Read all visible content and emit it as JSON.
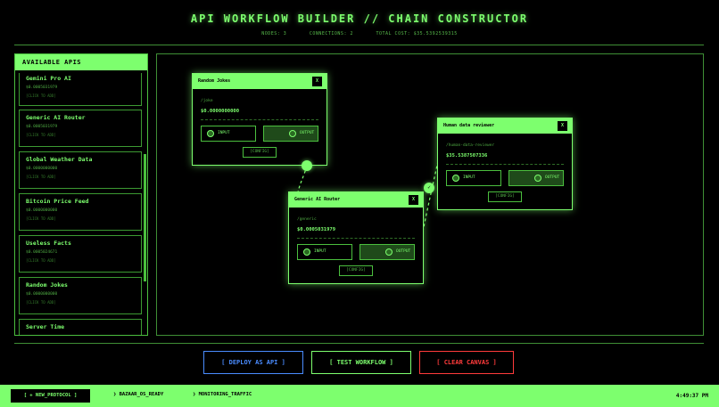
{
  "header": {
    "title": "API WORKFLOW BUILDER // CHAIN CONSTRUCTOR",
    "nodes": "NODES: 3",
    "connections": "CONNECTIONS: 2",
    "total_cost": "TOTAL COST: $35.5392539315"
  },
  "sidebar": {
    "title": "AVAILABLE APIS",
    "items": [
      {
        "name": "Gemini Pro AI",
        "price": "$0.0005031979",
        "hint": "[CLICK TO ADD]"
      },
      {
        "name": "Generic AI Router",
        "price": "$0.0005031979",
        "hint": "[CLICK TO ADD]"
      },
      {
        "name": "Global Weather Data",
        "price": "$0.0000000000",
        "hint": "[CLICK TO ADD]"
      },
      {
        "name": "Bitcoin Price Feed",
        "price": "$0.0000000000",
        "hint": "[CLICK TO ADD]"
      },
      {
        "name": "Useless Facts",
        "price": "$0.0005024671",
        "hint": "[CLICK TO ADD]"
      },
      {
        "name": "Random Jokes",
        "price": "$0.0000000000",
        "hint": "[CLICK TO ADD]"
      },
      {
        "name": "Server Time",
        "price": "",
        "hint": ""
      }
    ]
  },
  "canvas": {
    "nodes": [
      {
        "title": "Random Jokes",
        "close": "X",
        "path": "/joke",
        "price": "$0.0000000000",
        "input": "INPUT",
        "output": "OUTPUT",
        "config": "[CONFIG]"
      },
      {
        "title": "Generic AI Router",
        "close": "X",
        "path": "/generic",
        "price": "$0.0005031979",
        "input": "INPUT",
        "output": "OUTPUT",
        "config": "[CONFIG]"
      },
      {
        "title": "Human data reviewer",
        "close": "X",
        "path": "/human-data-reviewer",
        "price": "$35.5387507336",
        "input": "INPUT",
        "output": "OUTPUT",
        "config": "[CONFIG]"
      }
    ],
    "connection_marker": "✓"
  },
  "actions": {
    "deploy": "[ DEPLOY AS API ]",
    "test": "[ TEST WORKFLOW ]",
    "clear": "[ CLEAR CANVAS ]"
  },
  "footer": {
    "new_protocol": "[ + NEW_PROTOCOL ]",
    "status1": "❯ BAZAAR_OS_READY",
    "status2": "❯ MONITORING_TRAFFIC",
    "clock": "4:49:37 PM"
  },
  "colors": {
    "accent": "#7dff6e",
    "deploy": "#4a8cff",
    "clear": "#ff3b3b",
    "background": "#000000"
  }
}
